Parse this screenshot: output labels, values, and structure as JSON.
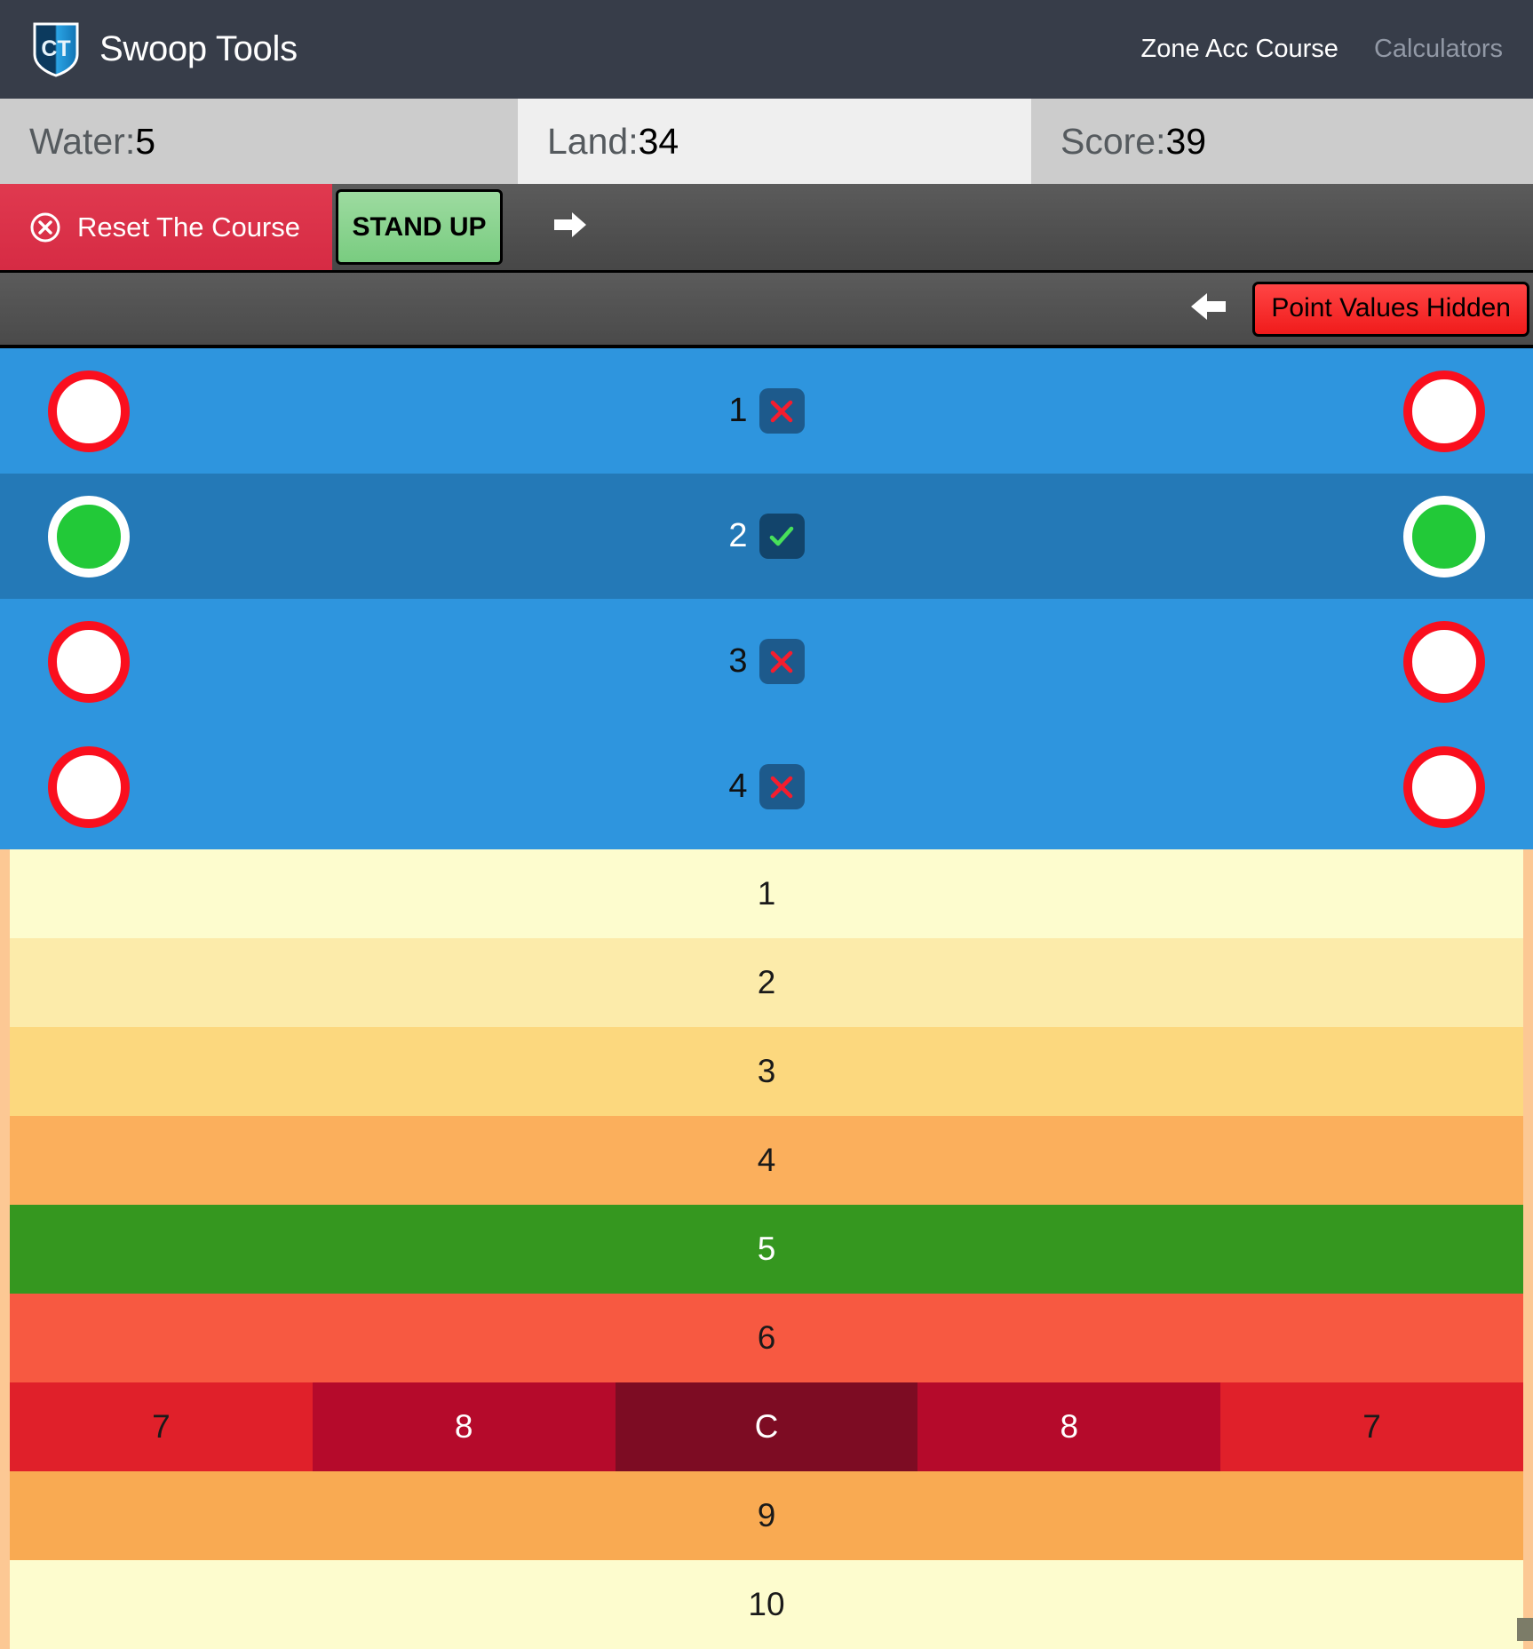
{
  "navbar": {
    "brand_title": "Swoop Tools",
    "logo_text": "CT",
    "links": [
      {
        "label": "Zone Acc Course",
        "active": true
      },
      {
        "label": "Calculators",
        "active": false
      }
    ]
  },
  "stats": [
    {
      "name": "water",
      "label": "Water:",
      "value": "5"
    },
    {
      "name": "land",
      "label": "Land:",
      "value": "34"
    },
    {
      "name": "score",
      "label": "Score:",
      "value": "39"
    }
  ],
  "toolbar": {
    "reset_label": "Reset The Course",
    "standup_label": "STAND UP",
    "forward_arrow": "right-arrow-icon",
    "back_arrow": "left-arrow-icon",
    "point_values_label": "Point Values Hidden"
  },
  "gates": [
    {
      "number": "1",
      "status": "miss",
      "mark": "x",
      "num_color": "dark",
      "stripe": "odd"
    },
    {
      "number": "2",
      "status": "hit",
      "mark": "check",
      "num_color": "light",
      "stripe": "even"
    },
    {
      "number": "3",
      "status": "miss",
      "mark": "x",
      "num_color": "dark",
      "stripe": "odd"
    },
    {
      "number": "4",
      "status": "miss",
      "mark": "x",
      "num_color": "dark",
      "stripe": "odd"
    }
  ],
  "zones": [
    {
      "label": "1",
      "bg": "#fdfcce",
      "fg": "#1a1a1a",
      "split": false
    },
    {
      "label": "2",
      "bg": "#fcebaa",
      "fg": "#1a1a1a",
      "split": false
    },
    {
      "label": "3",
      "bg": "#fcd87e",
      "fg": "#1a1a1a",
      "split": false
    },
    {
      "label": "4",
      "bg": "#fbaf5c",
      "fg": "#1a1a1a",
      "split": false
    },
    {
      "label": "5",
      "bg": "#35971f",
      "fg": "#ffffff",
      "split": false
    },
    {
      "label": "6",
      "bg": "#f75941",
      "fg": "#1a1a1a",
      "split": false
    },
    {
      "split": true,
      "cells": [
        {
          "label": "7",
          "bg": "#e0202a",
          "fg": "#1a1a1a"
        },
        {
          "label": "8",
          "bg": "#b50a2b",
          "fg": "#ffffff"
        },
        {
          "label": "C",
          "bg": "#7d0c23",
          "fg": "#ffffff"
        },
        {
          "label": "8",
          "bg": "#b50a2b",
          "fg": "#ffffff"
        },
        {
          "label": "7",
          "bg": "#e0202a",
          "fg": "#1a1a1a"
        }
      ]
    },
    {
      "label": "9",
      "bg": "#f9aa52",
      "fg": "#1a1a1a",
      "split": false
    },
    {
      "label": "10",
      "bg": "#fdfcce",
      "fg": "#1a1a1a",
      "split": false
    }
  ],
  "colors": {
    "nav_bg": "#373d49",
    "accent_red": "#d62b44",
    "accent_green": "#79cc80",
    "gate_blue": "#2e95de",
    "gate_blue_dark": "#2479b7",
    "zone_border": "#fcc894"
  }
}
